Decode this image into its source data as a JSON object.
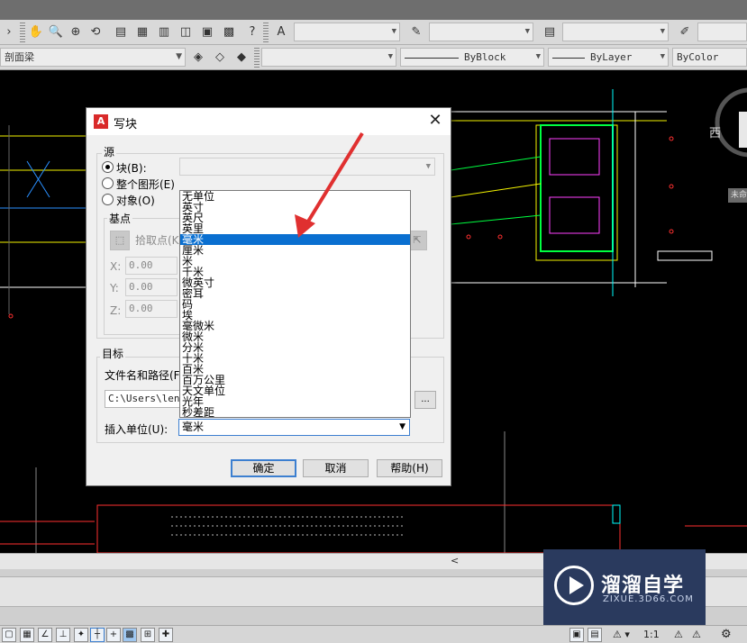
{
  "toolbar2": {
    "layer_name": "剖面梁",
    "linetype": "ByBlock",
    "lineweight": "ByLayer",
    "color": "ByColor"
  },
  "compass": {
    "west": "西",
    "unnamed": "未命名"
  },
  "dialog": {
    "title": "写块",
    "close": "✕",
    "source_label": "源",
    "radio_block": "块(B):",
    "radio_entire": "整个图形(E)",
    "radio_objects": "对象(O)",
    "basepoint_label": "基点",
    "pick_point": "拾取点(K)",
    "x_label": "X:",
    "y_label": "Y:",
    "z_label": "Z:",
    "x_value": "0.00",
    "y_value": "0.00",
    "z_value": "0.00",
    "target_label": "目标",
    "file_label": "文件名和路径(F):",
    "file_path": "C:\\Users\\lenovo",
    "browse": "...",
    "insert_units_label": "插入单位(U):",
    "insert_units_value": "毫米",
    "ok": "确定",
    "cancel": "取消",
    "help": "帮助(H)"
  },
  "unit_options": [
    "无单位",
    "英寸",
    "英尺",
    "英里",
    "毫米",
    "厘米",
    "米",
    "千米",
    "微英寸",
    "密耳",
    "码",
    "埃",
    "毫微米",
    "微米",
    "分米",
    "十米",
    "百米",
    "百万公里",
    "天文单位",
    "光年",
    "秒差距"
  ],
  "unit_selected_index": 4,
  "watermark": {
    "title": "溜溜自学",
    "url": "ZIXUE.3D66.COM"
  },
  "status": {
    "scale": "1:1"
  }
}
